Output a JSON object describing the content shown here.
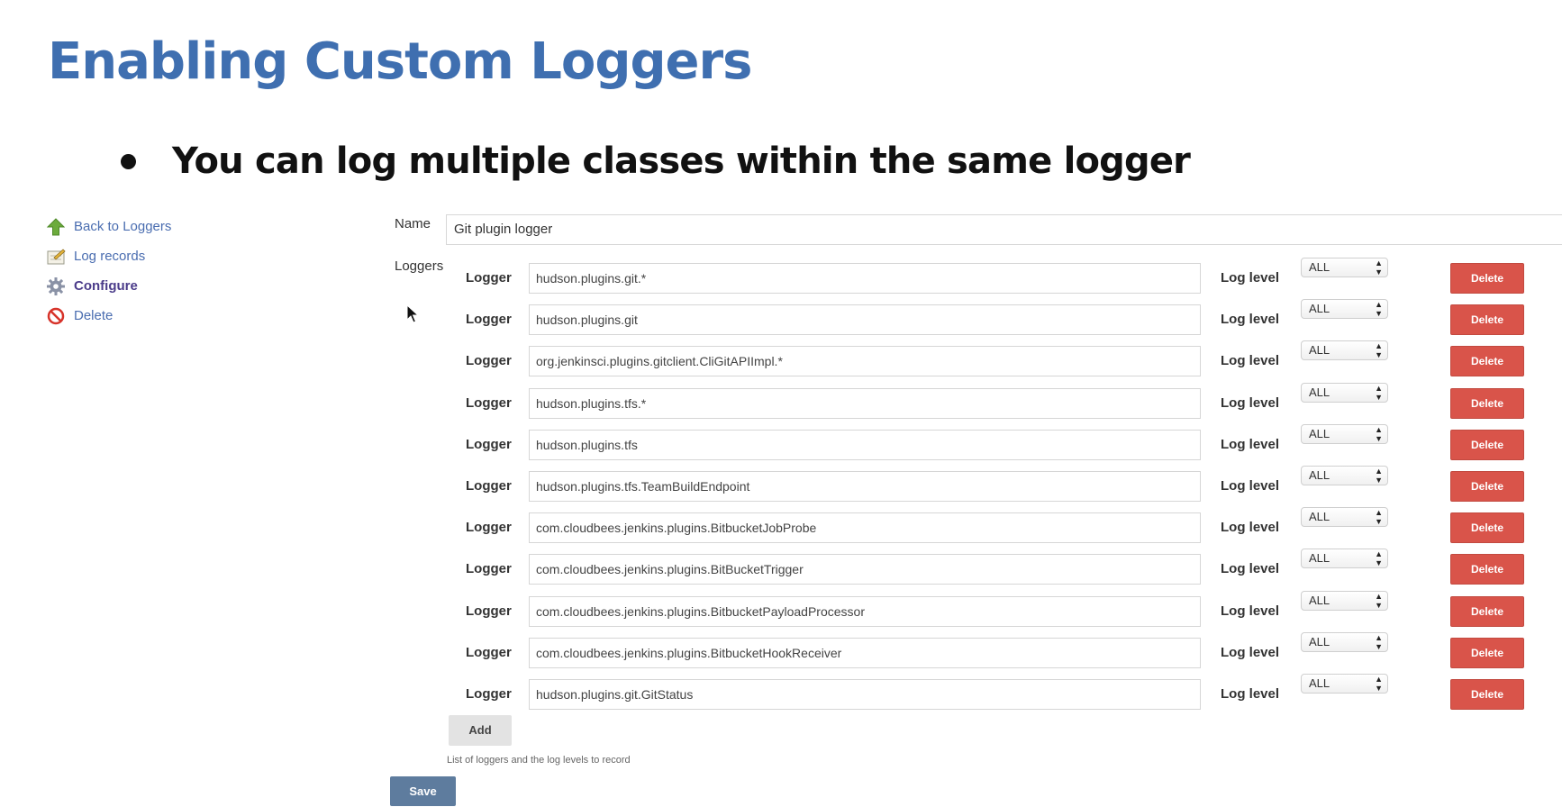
{
  "slide": {
    "title": "Enabling Custom Loggers",
    "bullet": "You can log multiple classes within the same logger"
  },
  "sidebar": {
    "items": [
      {
        "label": "Back to Loggers",
        "icon": "up-arrow-icon"
      },
      {
        "label": "Log records",
        "icon": "notepad-icon"
      },
      {
        "label": "Configure",
        "icon": "gear-icon"
      },
      {
        "label": "Delete",
        "icon": "no-entry-icon"
      }
    ]
  },
  "form": {
    "name_label": "Name",
    "name_value": "Git plugin logger",
    "loggers_label": "Loggers",
    "logger_label": "Logger",
    "log_level_label": "Log level",
    "delete_label": "Delete",
    "rows": [
      {
        "logger": "hudson.plugins.git.*",
        "level": "ALL"
      },
      {
        "logger": "hudson.plugins.git",
        "level": "ALL"
      },
      {
        "logger": "org.jenkinsci.plugins.gitclient.CliGitAPIImpl.*",
        "level": "ALL"
      },
      {
        "logger": "hudson.plugins.tfs.*",
        "level": "ALL"
      },
      {
        "logger": "hudson.plugins.tfs",
        "level": "ALL"
      },
      {
        "logger": "hudson.plugins.tfs.TeamBuildEndpoint",
        "level": "ALL"
      },
      {
        "logger": "com.cloudbees.jenkins.plugins.BitbucketJobProbe",
        "level": "ALL"
      },
      {
        "logger": "com.cloudbees.jenkins.plugins.BitBucketTrigger",
        "level": "ALL"
      },
      {
        "logger": "com.cloudbees.jenkins.plugins.BitbucketPayloadProcessor",
        "level": "ALL"
      },
      {
        "logger": "com.cloudbees.jenkins.plugins.BitbucketHookReceiver",
        "level": "ALL"
      },
      {
        "logger": "hudson.plugins.git.GitStatus",
        "level": "ALL"
      }
    ],
    "add_label": "Add",
    "help_text": "List of loggers and the log levels to record",
    "save_label": "Save"
  },
  "colors": {
    "title": "#3f6fb0",
    "delete_button": "#d9544a",
    "save_button": "#5e7c9e",
    "link": "#4a6db0"
  }
}
